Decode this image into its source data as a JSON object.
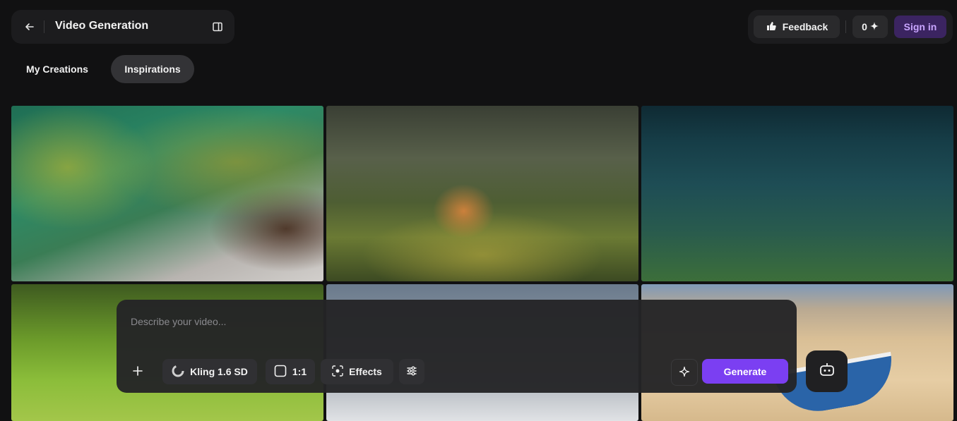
{
  "header": {
    "back_icon": "arrow-left-icon",
    "title": "Video Generation",
    "panel_icon": "sidebar-panel-icon"
  },
  "top_right": {
    "feedback_label": "Feedback",
    "feedback_icon": "thumbs-up-icon",
    "credits_value": "0",
    "credits_icon": "sparkle-icon",
    "signin_label": "Sign in"
  },
  "tabs": [
    {
      "label": "My Creations",
      "active": false
    },
    {
      "label": "Inspirations",
      "active": true
    }
  ],
  "gallery": {
    "items": [
      {
        "icon": "chameleon-thumbnail"
      },
      {
        "icon": "fox-thumbnail"
      },
      {
        "icon": "underwater-walker-thumbnail"
      },
      {
        "icon": "dog-in-grass-thumbnail"
      },
      {
        "icon": "rainbow-snow-thumbnail"
      },
      {
        "icon": "alien-boat-desert-thumbnail"
      }
    ]
  },
  "prompt": {
    "placeholder": "Describe your video...",
    "add_icon": "plus-icon",
    "model_label": "Kling 1.6 SD",
    "model_icon": "kling-logo-icon",
    "ratio_label": "1:1",
    "ratio_icon": "square-icon",
    "effects_label": "Effects",
    "effects_icon": "effects-focus-icon",
    "settings_icon": "sliders-icon",
    "enhance_icon": "sparkle-outline-icon",
    "generate_label": "Generate"
  },
  "assistant": {
    "icon": "robot-icon"
  },
  "colors": {
    "accent": "#7b3ff2",
    "signin_bg": "#3b2461",
    "signin_text": "#c9a5ff",
    "background": "#111112"
  }
}
